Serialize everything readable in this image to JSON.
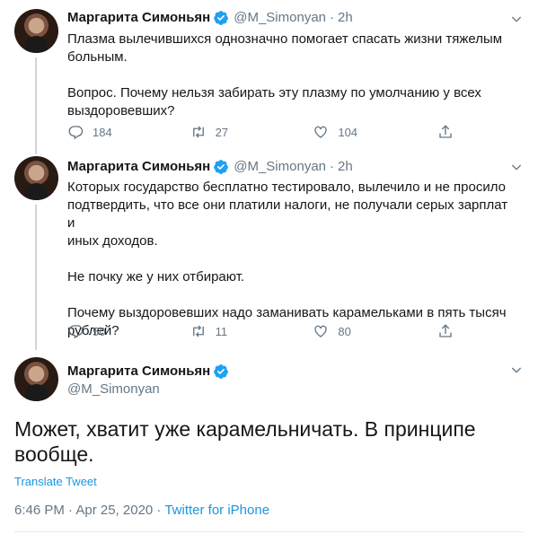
{
  "tweets": [
    {
      "name": "Маргарита Симоньян",
      "handle": "@M_Simonyan",
      "time": "2h",
      "text": "Плазма вылечившихся однозначно помогает спасать жизни тяжелым\nбольным.\n\nВопрос. Почему нельзя забирать эту плазму по умолчанию у всех\nвыздоровевших?",
      "replies": "184",
      "retweets": "27",
      "likes": "104"
    },
    {
      "name": "Маргарита Симоньян",
      "handle": "@M_Simonyan",
      "time": "2h",
      "text": "Которых государство бесплатно тестировало, вылечило и не просило\nподтвердить, что все они платили налоги, не получали серых зарплат и\nиных доходов.\n\nНе почку же у них отбирают.\n\nПочему выздоровевших надо заманивать карамельками в пять тысяч\nрублей?",
      "replies": "50",
      "retweets": "11",
      "likes": "80"
    }
  ],
  "main": {
    "name": "Маргарита Симоньян",
    "handle": "@M_Simonyan",
    "text": "Может, хватит уже карамельничать. В принципе вообще.",
    "translate": "Translate Tweet",
    "timestamp": "6:46 PM · Apr 25, 2020 · ",
    "source": "Twitter for iPhone"
  },
  "icons": {
    "verified": "verified-badge-icon",
    "menu": "chevron-down-icon",
    "reply": "reply-icon",
    "retweet": "retweet-icon",
    "like": "heart-icon",
    "share": "share-icon"
  },
  "colors": {
    "text": "#14171a",
    "muted": "#657786",
    "link": "#1b95e0",
    "thread": "#ccd6dd",
    "verified": "#1da1f2"
  }
}
